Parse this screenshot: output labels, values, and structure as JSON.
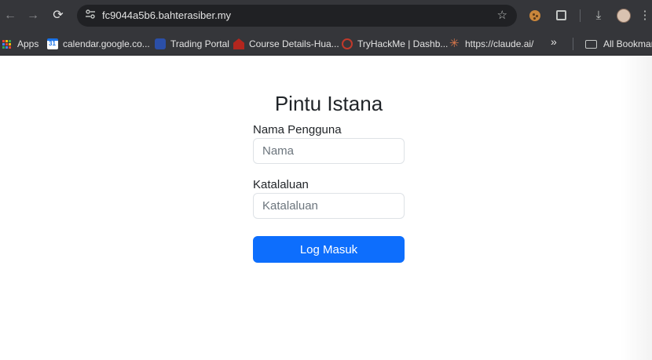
{
  "browser": {
    "url": "fc9044a5b6.bahterasiber.my",
    "nav": {
      "back_icon": "←",
      "forward_icon": "→",
      "reload_icon": "⟳"
    },
    "star_icon": "☆",
    "download_icon": "⤓",
    "menu_icon": "⋮"
  },
  "bookmarks": {
    "items": [
      {
        "label": "Apps"
      },
      {
        "label": "calendar.google.co..."
      },
      {
        "label": "Trading Portal"
      },
      {
        "label": "Course Details-Hua..."
      },
      {
        "label": "TryHackMe | Dashb..."
      },
      {
        "label": "https://claude.ai/"
      }
    ],
    "overflow_icon": "»",
    "all_bookmarks": "All Bookmarks"
  },
  "login": {
    "title": "Pintu Istana",
    "username_label": "Nama Pengguna",
    "username_placeholder": "Nama",
    "password_label": "Katalaluan",
    "password_placeholder": "Katalaluan",
    "submit_label": "Log Masuk"
  },
  "colors": {
    "accent": "#0d6efd",
    "browser_chrome": "#35363a"
  }
}
